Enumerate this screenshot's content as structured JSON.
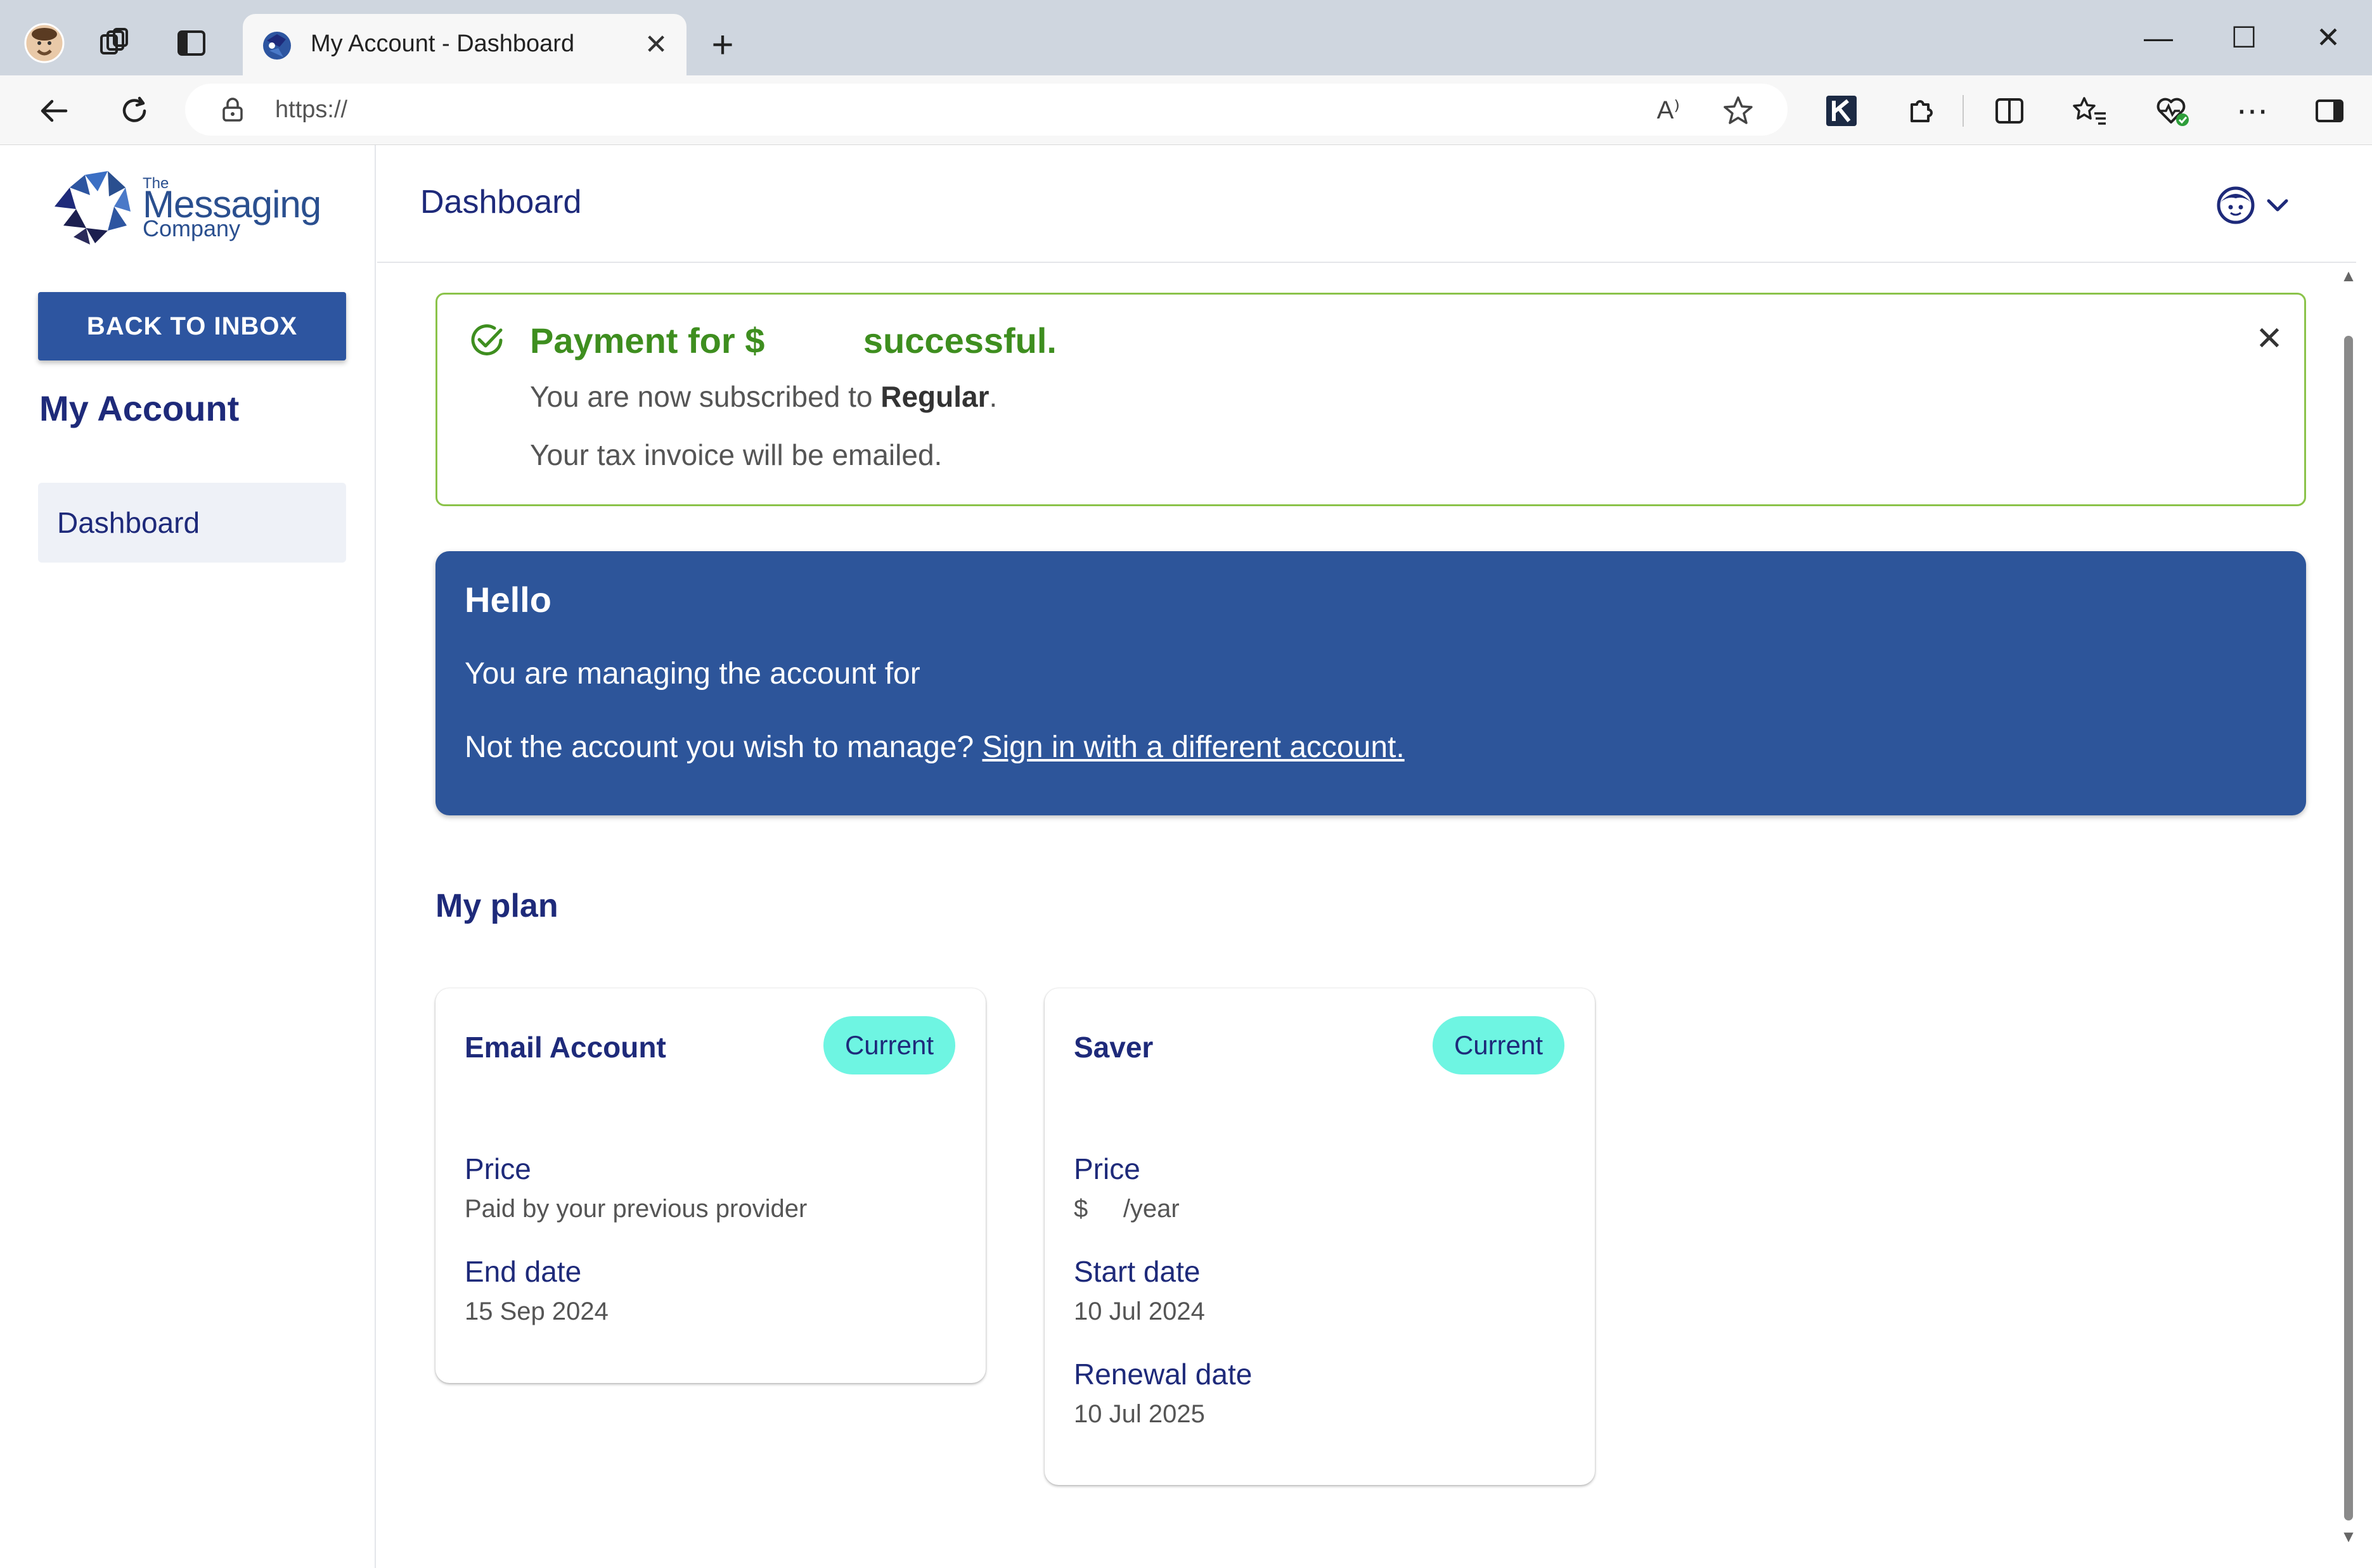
{
  "browser": {
    "tab_title": "My Account - Dashboard",
    "url": "https://",
    "new_tab_glyph": "+",
    "tab_close_glyph": "✕",
    "window_controls": {
      "minimize": "—",
      "maximize": "☐",
      "close": "✕"
    },
    "toolbar_icons": [
      "back-icon",
      "refresh-icon",
      "lock-icon",
      "read-aloud-icon",
      "favorite-star-icon",
      "extension-k-icon",
      "extensions-icon",
      "split-screen-icon",
      "favorites-icon",
      "browser-essentials-icon",
      "more-icon",
      "sidebar-icon"
    ],
    "read_aloud_glyph": "A⁾",
    "more_glyph": "⋯"
  },
  "sidebar": {
    "logo": {
      "the": "The",
      "main": "Messaging",
      "company": "Company"
    },
    "back_button": "BACK TO INBOX",
    "heading": "My Account",
    "nav_items": [
      {
        "label": "Dashboard"
      }
    ]
  },
  "header": {
    "title": "Dashboard"
  },
  "alert": {
    "title": "Payment for $          successful.",
    "line1_prefix": "You are now subscribed to ",
    "line1_plan": "Regular",
    "line1_suffix": ".",
    "line2": "Your tax invoice will be emailed.",
    "close_glyph": "✕"
  },
  "hello": {
    "title": "Hello",
    "line1": "You are managing the account for",
    "line2_prefix": "Not the account you wish to manage? ",
    "line2_link": "Sign in with a different account."
  },
  "plan": {
    "heading": "My plan",
    "cards": [
      {
        "title": "Email Account",
        "badge": "Current",
        "fields": [
          {
            "label": "Price",
            "value": "Paid by your previous provider"
          },
          {
            "label": "End date",
            "value": "15 Sep 2024"
          }
        ]
      },
      {
        "title": "Saver",
        "badge": "Current",
        "fields": [
          {
            "label": "Price",
            "value": "$     /year"
          },
          {
            "label": "Start date",
            "value": "10 Jul 2024"
          },
          {
            "label": "Renewal date",
            "value": "10 Jul 2025"
          }
        ]
      }
    ]
  },
  "colors": {
    "primary_blue": "#2d55a0",
    "heading_navy": "#1e2a7a",
    "success_green": "#3e8e1f",
    "success_border": "#8bc34a",
    "badge_teal": "#6ef5e2"
  }
}
